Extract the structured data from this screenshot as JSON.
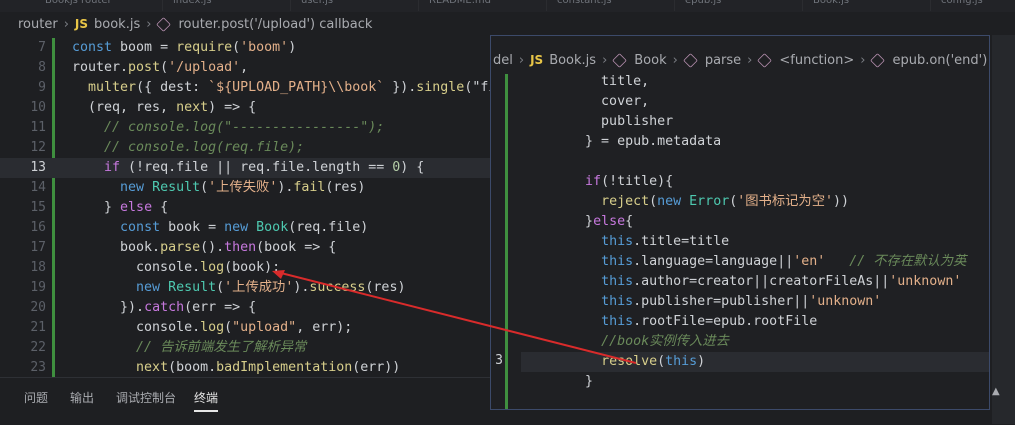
{
  "top_tabs": [
    "Bookjs router",
    "index.js",
    "user.js",
    "README.md",
    "constant.js",
    "epub.js",
    "Book.js",
    "config.js"
  ],
  "left_breadcrumb": {
    "folder": "router",
    "js_badge": "JS",
    "file": "book.js",
    "symbol": "router.post('/upload') callback"
  },
  "right_breadcrumb": {
    "folder": "del",
    "js_badge": "JS",
    "file": "Book.js",
    "items": [
      "Book",
      "parse",
      "<function>",
      "epub.on('end') callback"
    ]
  },
  "left_editor": {
    "current_line": 13,
    "lines": [
      {
        "n": "7",
        "text": "const boom = require('boom')"
      },
      {
        "n": "8",
        "text": "router.post('/upload',"
      },
      {
        "n": "9",
        "text": "  multer({ dest: `${UPLOAD_PATH}\\\\book` }).single(\"fi"
      },
      {
        "n": "10",
        "text": "  (req, res, next) => {"
      },
      {
        "n": "11",
        "text": "    // console.log(\"----------------\");"
      },
      {
        "n": "12",
        "text": "    // console.log(req.file);"
      },
      {
        "n": "13",
        "text": "    if (!req.file || req.file.length == 0) {"
      },
      {
        "n": "14",
        "text": "      new Result('上传失败').fail(res)"
      },
      {
        "n": "15",
        "text": "    } else {"
      },
      {
        "n": "16",
        "text": "      const book = new Book(req.file)"
      },
      {
        "n": "17",
        "text": "      book.parse().then(book => {"
      },
      {
        "n": "18",
        "text": "        console.log(book);"
      },
      {
        "n": "19",
        "text": "        new Result('上传成功').success(res)"
      },
      {
        "n": "20",
        "text": "      }).catch(err => {"
      },
      {
        "n": "21",
        "text": "        console.log(\"upload\", err);"
      },
      {
        "n": "22",
        "text": "        // 告诉前端发生了解析异常"
      },
      {
        "n": "23",
        "text": "        next(boom.badImplementation(err))"
      }
    ]
  },
  "right_editor": {
    "cursor_line_number": "3",
    "lines": [
      "          title,",
      "          cover,",
      "          publisher",
      "        } = epub.metadata",
      "",
      "        if(!title){",
      "          reject(new Error('图书标记为空'))",
      "        }else{",
      "          this.title=title",
      "          this.language=language||'en'   // 不存在默认为英",
      "          this.author=creator||creatorFileAs||'unknown'",
      "          this.publisher=publisher||'unknown'",
      "          this.rootFile=epub.rootFile",
      "          //book实例传入进去",
      "          resolve(this)",
      "        }"
    ]
  },
  "panel_tabs": [
    {
      "label": "问题",
      "active": false
    },
    {
      "label": "输出",
      "active": false
    },
    {
      "label": "调试控制台",
      "active": false
    },
    {
      "label": "终端",
      "active": true
    }
  ],
  "colors": {
    "annotation_arrow": "#d92b2b",
    "float_border": "#3c4a6a",
    "added_line_bar": "#3f8f3f"
  }
}
